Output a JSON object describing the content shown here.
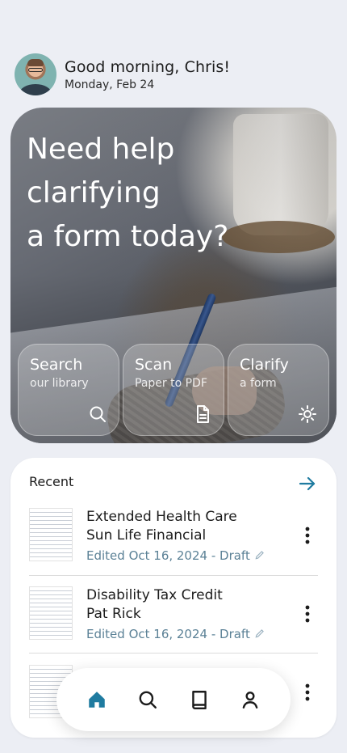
{
  "header": {
    "greeting": "Good morning, Chris!",
    "date": "Monday, Feb 24"
  },
  "hero": {
    "line1": "Need help",
    "line2": "clarifying",
    "line3": "a form today?",
    "actions": [
      {
        "title": "Search",
        "subtitle": "our library",
        "icon": "search-icon"
      },
      {
        "title": "Scan",
        "subtitle": "Paper to PDF",
        "icon": "document-icon"
      },
      {
        "title": "Clarify",
        "subtitle": "a form",
        "icon": "sparkle-icon"
      }
    ]
  },
  "recent": {
    "label": "Recent",
    "items": [
      {
        "line1": "Extended Health Care",
        "line2": "Sun Life Financial",
        "edited": "Edited Oct 16, 2024 - Draft"
      },
      {
        "line1": "Disability Tax Credit",
        "line2": "Pat Rick",
        "edited": "Edited Oct 16, 2024 - Draft"
      }
    ]
  },
  "nav": {
    "items": [
      {
        "icon": "home-icon",
        "active": true
      },
      {
        "icon": "search-icon",
        "active": false
      },
      {
        "icon": "book-icon",
        "active": false
      },
      {
        "icon": "profile-icon",
        "active": false
      }
    ]
  },
  "colors": {
    "accent": "#1f7ba0",
    "edited_text": "#5b8196",
    "background": "#eceef4"
  }
}
